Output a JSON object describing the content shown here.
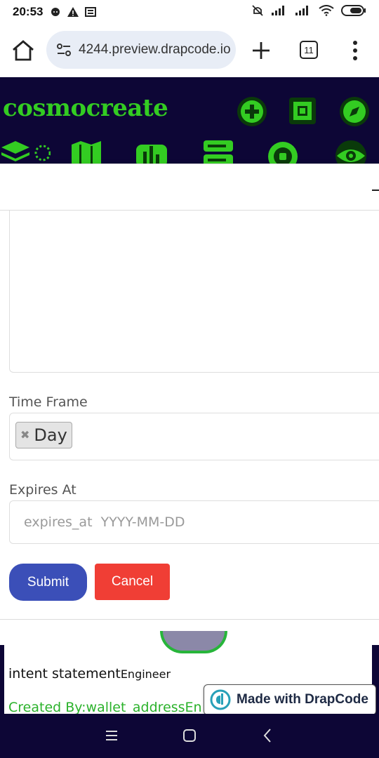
{
  "status_bar": {
    "time": "20:53",
    "icons": [
      "chat-icon",
      "warning-icon",
      "news-icon",
      "mute-icon",
      "signal-icon",
      "signal-icon",
      "wifi-icon",
      "battery-icon"
    ]
  },
  "browser": {
    "url": "4244.preview.drapcode.io",
    "tab_count": "11"
  },
  "app": {
    "brand": "cosmocreate",
    "accent": "#33cc22",
    "header_bg": "#0d0636"
  },
  "form": {
    "time_frame_label": "Time Frame",
    "time_frame_value": "Day",
    "expires_label": "Expires At",
    "expires_placeholder": "expires_at  YYYY-MM-DD",
    "submit_label": "Submit",
    "cancel_label": "Cancel"
  },
  "card": {
    "intent": "intent statement",
    "intent_sub": "Engineer",
    "created": "Created By:wallet_addressEn"
  },
  "badge": {
    "label": "Made with DrapCode"
  }
}
